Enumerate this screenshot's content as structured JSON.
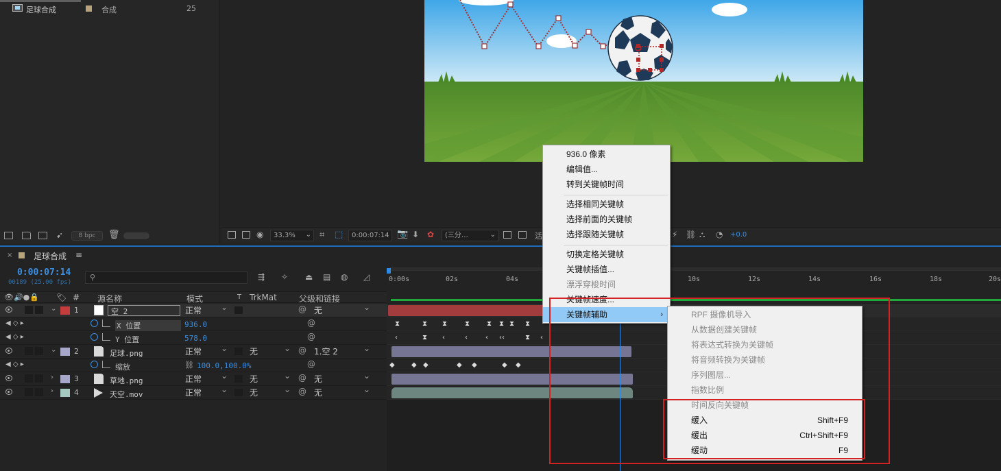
{
  "project": {
    "item_name": "足球合成",
    "item_type": "合成",
    "item_fps": "25",
    "bpc": "8 bpc"
  },
  "viewer": {
    "zoom": "33.3%",
    "timecode": "0:00:07:14",
    "resolution": "(三分…",
    "lock_text": "活",
    "exposure": "+0.0"
  },
  "timeline": {
    "close": "×",
    "title": "足球合成",
    "menu": "≡",
    "current_time": "0:00:07:14",
    "frames": "00189 (25.00 fps)",
    "headers": {
      "num": "#",
      "source_name": "源名称",
      "mode": "模式",
      "t": "T",
      "trkmat": "TrkMat",
      "parent": "父级和链接"
    },
    "ruler": [
      "0:00s",
      "02s",
      "04s",
      "10s",
      "12s",
      "14s",
      "16s",
      "18s",
      "20s"
    ],
    "layers": [
      {
        "num": "1",
        "name": "空 2",
        "mode": "正常",
        "trkmat": "",
        "parent": "无",
        "color": "#c43c3c",
        "twirl": "⌄"
      },
      {
        "num": "2",
        "name": "足球.png",
        "mode": "正常",
        "trkmat": "无",
        "parent": "1.空 2",
        "color": "#a7a7c9",
        "twirl": "⌄"
      },
      {
        "num": "3",
        "name": "草地.png",
        "mode": "正常",
        "trkmat": "无",
        "parent": "无",
        "color": "#a7a7c9",
        "twirl": "›"
      },
      {
        "num": "4",
        "name": "天空.mov",
        "mode": "正常",
        "trkmat": "无",
        "parent": "无",
        "color": "#a3c9c0",
        "twirl": "›"
      }
    ],
    "props": [
      {
        "name": "X 位置",
        "value": "936.0"
      },
      {
        "name": "Y 位置",
        "value": "578.0"
      },
      {
        "name": "缩放",
        "value": "100.0,100.0%"
      }
    ]
  },
  "context_menu": {
    "items": [
      {
        "label": "936.0 像素",
        "disabled": false
      },
      {
        "label": "编辑值...",
        "disabled": false
      },
      {
        "label": "转到关键帧时间",
        "disabled": false
      },
      {
        "label": "选择相同关键帧",
        "disabled": false
      },
      {
        "label": "选择前面的关键帧",
        "disabled": false
      },
      {
        "label": "选择跟随关键帧",
        "disabled": false
      },
      {
        "label": "切换定格关键帧",
        "disabled": false
      },
      {
        "label": "关键帧插值...",
        "disabled": false
      },
      {
        "label": "漂浮穿梭时间",
        "disabled": true
      },
      {
        "label": "关键帧速度...",
        "disabled": false
      },
      {
        "label": "关键帧辅助",
        "disabled": false
      }
    ],
    "submenu_arrow": "›"
  },
  "submenu": {
    "items": [
      {
        "label": "RPF 摄像机导入",
        "shortcut": "",
        "disabled": true
      },
      {
        "label": "从数据创建关键帧",
        "shortcut": "",
        "disabled": true
      },
      {
        "label": "将表达式转换为关键帧",
        "shortcut": "",
        "disabled": true
      },
      {
        "label": "将音频转换为关键帧",
        "shortcut": "",
        "disabled": true
      },
      {
        "label": "序列图层...",
        "shortcut": "",
        "disabled": true
      },
      {
        "label": "指数比例",
        "shortcut": "",
        "disabled": true
      },
      {
        "label": "时间反向关键帧",
        "shortcut": "",
        "disabled": true
      },
      {
        "label": "缓入",
        "shortcut": "Shift+F9",
        "disabled": false
      },
      {
        "label": "缓出",
        "shortcut": "Ctrl+Shift+F9",
        "disabled": false
      },
      {
        "label": "缓动",
        "shortcut": "F9",
        "disabled": false
      }
    ]
  }
}
